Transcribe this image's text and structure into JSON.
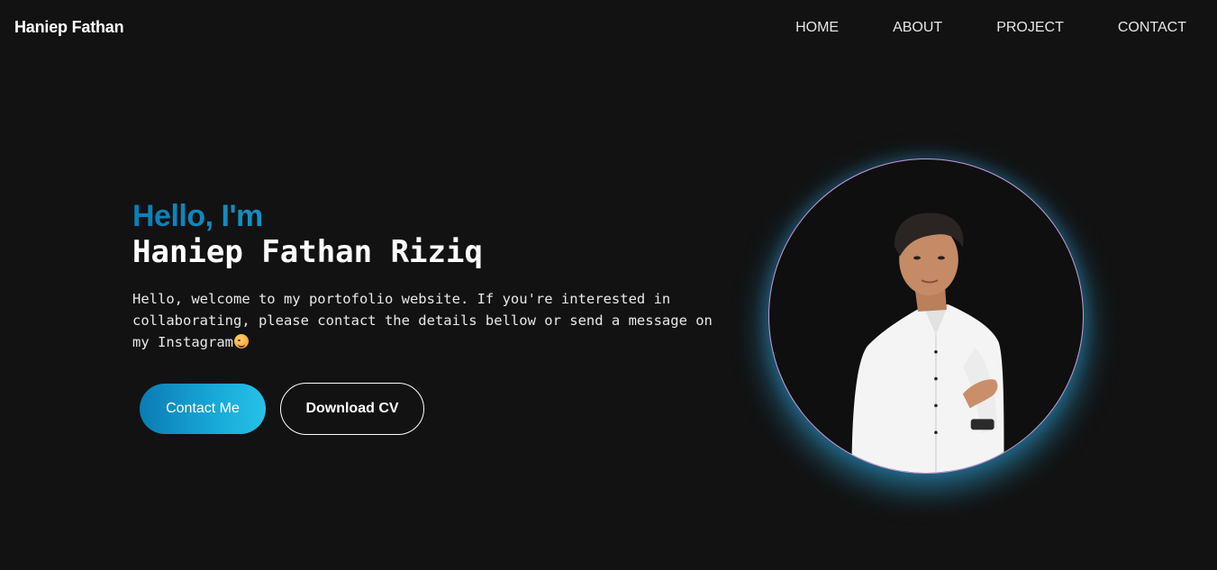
{
  "brand": "Haniep Fathan",
  "nav": {
    "items": [
      "HOME",
      "ABOUT",
      "PROJECT",
      "CONTACT"
    ]
  },
  "hero": {
    "greeting": "Hello, I'm",
    "name": "Haniep Fathan Riziq",
    "intro": "Hello, welcome to my portofolio website. If you're interested in collaborating, please contact the details bellow or send a message on my Instagram",
    "emoji": "winking-face-emoji",
    "contact_button": "Contact Me",
    "download_button": "Download CV"
  },
  "profile": {
    "image": "profile-photo"
  },
  "colors": {
    "background": "#121212",
    "accent_start": "#0b7bb4",
    "accent_end": "#26c1e8",
    "ring_border": "#c79ad9",
    "glow": "#2ca0d2"
  }
}
